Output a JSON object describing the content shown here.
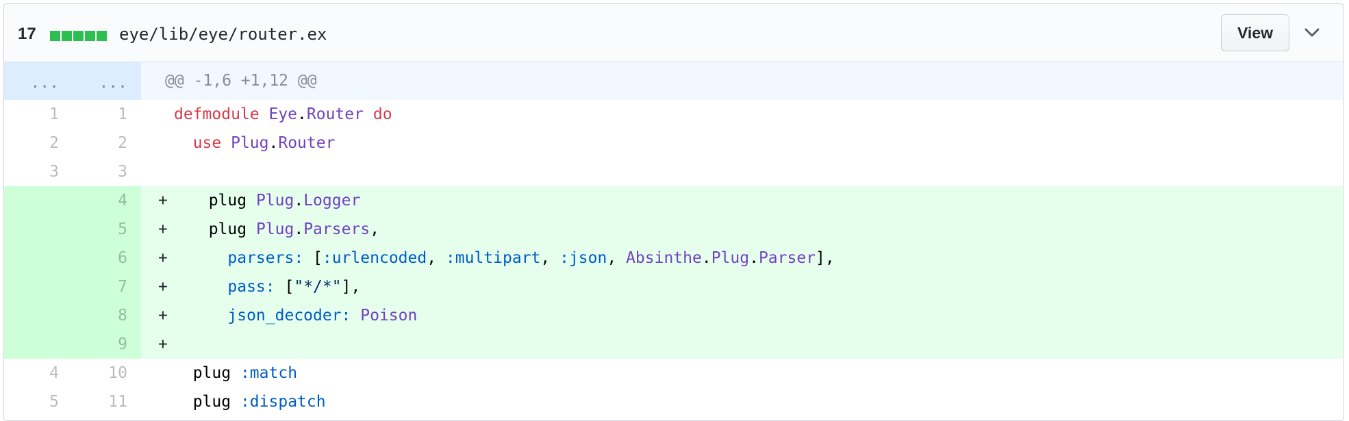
{
  "file": {
    "diffstat_count": "17",
    "diffstat_blocks": 5,
    "path": "eye/lib/eye/router.ex",
    "view_label": "View",
    "colors": {
      "addition": "#2cbe4e",
      "hunk": "#f1f8ff",
      "added_line": "#e6ffed"
    }
  },
  "hunk": {
    "old_marker": "...",
    "new_marker": "...",
    "header": "@@ -1,6 +1,12 @@"
  },
  "lines": [
    {
      "type": "context",
      "old": "1",
      "new": "1",
      "tokens": [
        [
          "kw",
          "defmodule"
        ],
        [
          "",
          ""
        ],
        [
          "sp",
          " "
        ],
        [
          "mod",
          "Eye"
        ],
        [
          "",
          "."
        ],
        [
          "mod",
          "Router"
        ],
        [
          "sp",
          " "
        ],
        [
          "kw",
          "do"
        ]
      ]
    },
    {
      "type": "context",
      "old": "2",
      "new": "2",
      "tokens": [
        [
          "sp",
          "  "
        ],
        [
          "kw",
          "use"
        ],
        [
          "sp",
          " "
        ],
        [
          "mod",
          "Plug"
        ],
        [
          "",
          "."
        ],
        [
          "mod",
          "Router"
        ]
      ]
    },
    {
      "type": "context",
      "old": "3",
      "new": "3",
      "tokens": []
    },
    {
      "type": "add",
      "old": "",
      "new": "4",
      "tokens": [
        [
          "sp",
          "  "
        ],
        [
          "",
          "plug"
        ],
        [
          "sp",
          " "
        ],
        [
          "mod",
          "Plug"
        ],
        [
          "",
          "."
        ],
        [
          "mod",
          "Logger"
        ]
      ]
    },
    {
      "type": "add",
      "old": "",
      "new": "5",
      "tokens": [
        [
          "sp",
          "  "
        ],
        [
          "",
          "plug"
        ],
        [
          "sp",
          " "
        ],
        [
          "mod",
          "Plug"
        ],
        [
          "",
          "."
        ],
        [
          "mod",
          "Parsers"
        ],
        [
          "",
          ","
        ]
      ]
    },
    {
      "type": "add",
      "old": "",
      "new": "6",
      "tokens": [
        [
          "sp",
          "    "
        ],
        [
          "atom",
          "parsers:"
        ],
        [
          "sp",
          " "
        ],
        [
          "",
          "["
        ],
        [
          "atom",
          ":urlencoded"
        ],
        [
          "",
          ", "
        ],
        [
          "atom",
          ":multipart"
        ],
        [
          "",
          ", "
        ],
        [
          "atom",
          ":json"
        ],
        [
          "",
          ", "
        ],
        [
          "mod",
          "Absinthe"
        ],
        [
          "",
          "."
        ],
        [
          "mod",
          "Plug"
        ],
        [
          "",
          "."
        ],
        [
          "mod",
          "Parser"
        ],
        [
          "",
          "],"
        ]
      ]
    },
    {
      "type": "add",
      "old": "",
      "new": "7",
      "tokens": [
        [
          "sp",
          "    "
        ],
        [
          "atom",
          "pass:"
        ],
        [
          "sp",
          " "
        ],
        [
          "",
          "["
        ],
        [
          "str",
          "\"*/*\""
        ],
        [
          "",
          "],"
        ]
      ]
    },
    {
      "type": "add",
      "old": "",
      "new": "8",
      "tokens": [
        [
          "sp",
          "    "
        ],
        [
          "atom",
          "json_decoder:"
        ],
        [
          "sp",
          " "
        ],
        [
          "mod",
          "Poison"
        ]
      ]
    },
    {
      "type": "add",
      "old": "",
      "new": "9",
      "tokens": []
    },
    {
      "type": "context",
      "old": "4",
      "new": "10",
      "tokens": [
        [
          "sp",
          "  "
        ],
        [
          "",
          "plug"
        ],
        [
          "sp",
          " "
        ],
        [
          "atom",
          ":match"
        ]
      ]
    },
    {
      "type": "context",
      "old": "5",
      "new": "11",
      "tokens": [
        [
          "sp",
          "  "
        ],
        [
          "",
          "plug"
        ],
        [
          "sp",
          " "
        ],
        [
          "atom",
          ":dispatch"
        ]
      ]
    }
  ]
}
